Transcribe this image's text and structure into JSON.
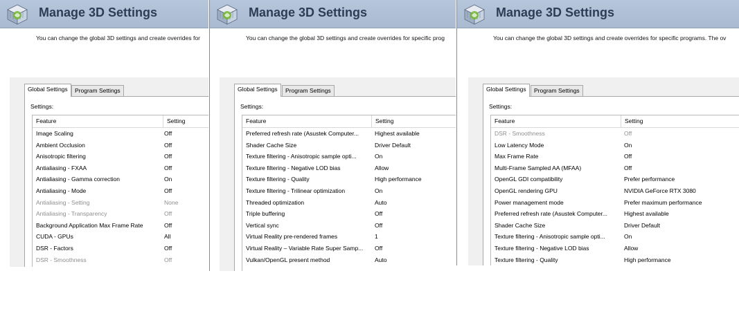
{
  "panels": [
    {
      "title": "Manage 3D Settings",
      "description": "You can change the global 3D settings and create overrides for",
      "tabs": [
        "Global Settings",
        "Program Settings"
      ],
      "settings_label": "Settings:",
      "columns": {
        "feature": "Feature",
        "setting": "Setting"
      },
      "rows": [
        {
          "feature": "Image Scaling",
          "setting": "Off",
          "disabled": false
        },
        {
          "feature": "Ambient Occlusion",
          "setting": "Off",
          "disabled": false
        },
        {
          "feature": "Anisotropic filtering",
          "setting": "Off",
          "disabled": false
        },
        {
          "feature": "Antialiasing - FXAA",
          "setting": "Off",
          "disabled": false
        },
        {
          "feature": "Antialiasing - Gamma correction",
          "setting": "On",
          "disabled": false
        },
        {
          "feature": "Antialiasing - Mode",
          "setting": "Off",
          "disabled": false
        },
        {
          "feature": "Antialiasing - Setting",
          "setting": "None",
          "disabled": true
        },
        {
          "feature": "Antialiasing - Transparency",
          "setting": "Off",
          "disabled": true
        },
        {
          "feature": "Background Application Max Frame Rate",
          "setting": "Off",
          "disabled": false
        },
        {
          "feature": "CUDA - GPUs",
          "setting": "All",
          "disabled": false
        },
        {
          "feature": "DSR - Factors",
          "setting": "Off",
          "disabled": false
        },
        {
          "feature": "DSR - Smoothness",
          "setting": "Off",
          "disabled": true
        }
      ]
    },
    {
      "title": "Manage 3D Settings",
      "description": "You can change the global 3D settings and create overrides for specific prog",
      "tabs": [
        "Global Settings",
        "Program Settings"
      ],
      "settings_label": "Settings:",
      "columns": {
        "feature": "Feature",
        "setting": "Setting"
      },
      "rows": [
        {
          "feature": "Preferred refresh rate (Asustek Computer...",
          "setting": "Highest available",
          "disabled": false
        },
        {
          "feature": "Shader Cache Size",
          "setting": "Driver Default",
          "disabled": false
        },
        {
          "feature": "Texture filtering - Anisotropic sample opti...",
          "setting": "On",
          "disabled": false
        },
        {
          "feature": "Texture filtering - Negative LOD bias",
          "setting": "Allow",
          "disabled": false
        },
        {
          "feature": "Texture filtering - Quality",
          "setting": "High performance",
          "disabled": false
        },
        {
          "feature": "Texture filtering - Trilinear optimization",
          "setting": "On",
          "disabled": false
        },
        {
          "feature": "Threaded optimization",
          "setting": "Auto",
          "disabled": false
        },
        {
          "feature": "Triple buffering",
          "setting": "Off",
          "disabled": false
        },
        {
          "feature": "Vertical sync",
          "setting": "Off",
          "disabled": false
        },
        {
          "feature": "Virtual Reality pre-rendered frames",
          "setting": "1",
          "disabled": false
        },
        {
          "feature": "Virtual Reality – Variable Rate Super Samp...",
          "setting": "Off",
          "disabled": false
        },
        {
          "feature": "Vulkan/OpenGL present method",
          "setting": "Auto",
          "disabled": false
        }
      ]
    },
    {
      "title": "Manage 3D Settings",
      "description": "You can change the global 3D settings and create overrides for specific programs. The ov",
      "tabs": [
        "Global Settings",
        "Program Settings"
      ],
      "settings_label": "Settings:",
      "columns": {
        "feature": "Feature",
        "setting": "Setting"
      },
      "rows": [
        {
          "feature": "DSR - Smoothness",
          "setting": "Off",
          "disabled": true
        },
        {
          "feature": "Low Latency Mode",
          "setting": "On",
          "disabled": false
        },
        {
          "feature": "Max Frame Rate",
          "setting": "Off",
          "disabled": false
        },
        {
          "feature": "Multi-Frame Sampled AA (MFAA)",
          "setting": "Off",
          "disabled": false
        },
        {
          "feature": "OpenGL GDI compatibility",
          "setting": "Prefer performance",
          "disabled": false
        },
        {
          "feature": "OpenGL rendering GPU",
          "setting": "NVIDIA GeForce RTX 3080",
          "disabled": false
        },
        {
          "feature": "Power management mode",
          "setting": "Prefer maximum performance",
          "disabled": false
        },
        {
          "feature": "Preferred refresh rate (Asustek Computer...",
          "setting": "Highest available",
          "disabled": false
        },
        {
          "feature": "Shader Cache Size",
          "setting": "Driver Default",
          "disabled": false
        },
        {
          "feature": "Texture filtering - Anisotropic sample opti...",
          "setting": "On",
          "disabled": false
        },
        {
          "feature": "Texture filtering - Negative LOD bias",
          "setting": "Allow",
          "disabled": false
        },
        {
          "feature": "Texture filtering - Quality",
          "setting": "High performance",
          "disabled": false
        }
      ]
    }
  ],
  "colors": {
    "header_bg": "#b3c3d8",
    "title_text": "#2c3e55",
    "disabled_text": "#8e8e8e"
  },
  "icons": {
    "header_logo": "nvidia-3d-settings-icon"
  }
}
